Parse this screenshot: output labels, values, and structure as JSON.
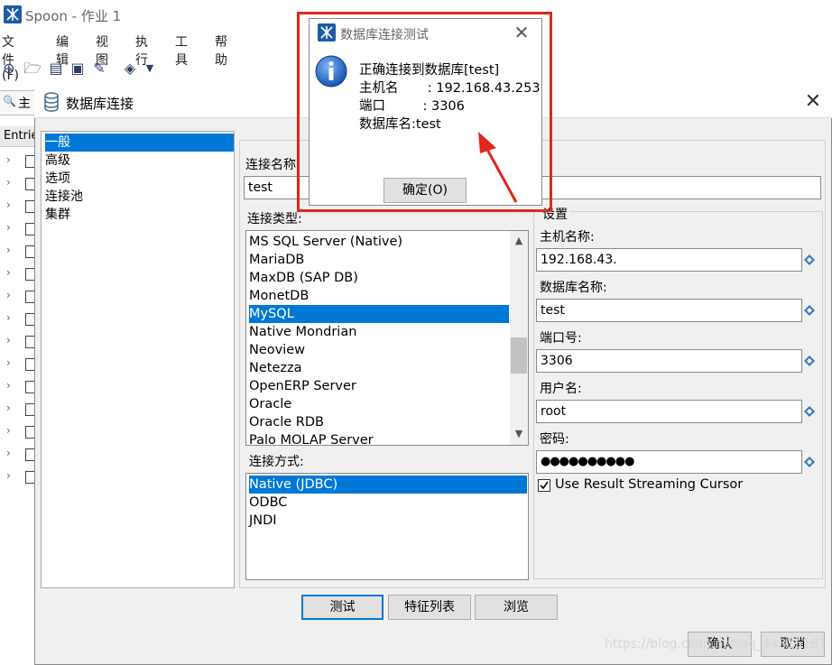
{
  "window": {
    "title": "Spoon - 作业 1",
    "menu": [
      "文件(F)",
      "编辑",
      "视图",
      "执行",
      "工具",
      "帮助"
    ],
    "side_tab_label": "主",
    "entries_label": "Entries"
  },
  "db_dialog": {
    "title": "数据库连接",
    "categories": [
      "一般",
      "高级",
      "选项",
      "连接池",
      "集群"
    ],
    "selected_category": "一般",
    "connection_name_label": "连接名称:",
    "connection_name_value": "test",
    "connection_type_label": "连接类型:",
    "connection_types": [
      "MS SQL Server (Native)",
      "MariaDB",
      "MaxDB (SAP DB)",
      "MonetDB",
      "MySQL",
      "Native Mondrian",
      "Neoview",
      "Netezza",
      "OpenERP Server",
      "Oracle",
      "Oracle RDB",
      "Palo MOLAP Server"
    ],
    "selected_connection_type": "MySQL",
    "access_label": "连接方式:",
    "access_methods": [
      "Native (JDBC)",
      "ODBC",
      "JNDI"
    ],
    "selected_access": "Native (JDBC)",
    "settings": {
      "group_label": "设置",
      "host_label": "主机名称:",
      "host_value": "192.168.43.",
      "dbname_label": "数据库名称:",
      "dbname_value": "test",
      "port_label": "端口号:",
      "port_value": "3306",
      "user_label": "用户名:",
      "user_value": "root",
      "password_label": "密码:",
      "password_value": "●●●●●●●●●●",
      "streaming_label": "Use Result Streaming Cursor",
      "streaming_checked": true
    },
    "buttons": {
      "test": "测试",
      "features": "特征列表",
      "explore": "浏览",
      "ok": "确认",
      "cancel": "取消"
    }
  },
  "message": {
    "title": "数据库连接测试",
    "lines": [
      "正确连接到数据库[test]",
      "主机名       : 192.168.43.253",
      "端口         : 3306",
      "数据库名:test"
    ],
    "ok_button": "确定(O)"
  },
  "watermark": "https://blog.csdn.net/qq_44815181",
  "colors": {
    "selection": "#0078d7",
    "highlight_frame": "#e1261c",
    "brand_icon": "#1e5aa8"
  }
}
